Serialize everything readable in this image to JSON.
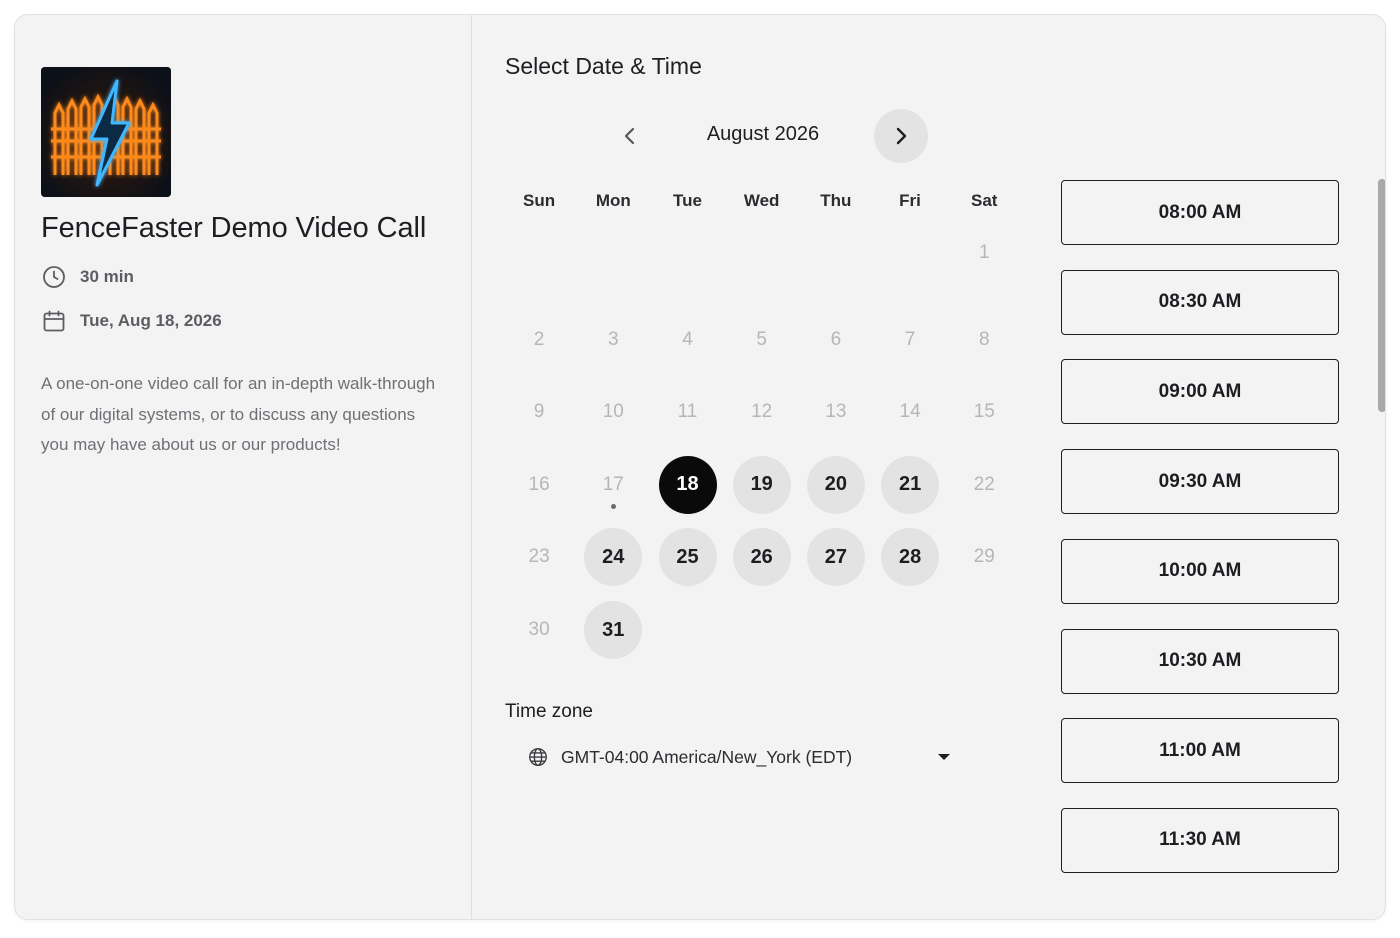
{
  "event": {
    "logo_icon": "neon-fence-lightning-logo",
    "title": "FenceFaster Demo Video Call",
    "duration": "30 min",
    "date": "Tue, Aug 18, 2026",
    "description": "A one-on-one video call for an in-depth walk-through of our digital systems, or to discuss any questions you may have about us or our products!"
  },
  "scheduler": {
    "title": "Select Date & Time",
    "month_label": "August 2026",
    "prev_icon": "chevron-left-icon",
    "next_icon": "chevron-right-icon",
    "weekdays": [
      "Sun",
      "Mon",
      "Tue",
      "Wed",
      "Thu",
      "Fri",
      "Sat"
    ],
    "days": [
      {
        "label": "1",
        "state": "disabled"
      },
      {
        "label": "2",
        "state": "disabled"
      },
      {
        "label": "3",
        "state": "disabled"
      },
      {
        "label": "4",
        "state": "disabled"
      },
      {
        "label": "5",
        "state": "disabled"
      },
      {
        "label": "6",
        "state": "disabled"
      },
      {
        "label": "7",
        "state": "disabled"
      },
      {
        "label": "8",
        "state": "disabled"
      },
      {
        "label": "9",
        "state": "disabled"
      },
      {
        "label": "10",
        "state": "disabled"
      },
      {
        "label": "11",
        "state": "disabled"
      },
      {
        "label": "12",
        "state": "disabled"
      },
      {
        "label": "13",
        "state": "disabled"
      },
      {
        "label": "14",
        "state": "disabled"
      },
      {
        "label": "15",
        "state": "disabled"
      },
      {
        "label": "16",
        "state": "disabled"
      },
      {
        "label": "17",
        "state": "disabled",
        "today": true
      },
      {
        "label": "18",
        "state": "selected"
      },
      {
        "label": "19",
        "state": "available"
      },
      {
        "label": "20",
        "state": "available"
      },
      {
        "label": "21",
        "state": "available"
      },
      {
        "label": "22",
        "state": "disabled"
      },
      {
        "label": "23",
        "state": "disabled"
      },
      {
        "label": "24",
        "state": "available"
      },
      {
        "label": "25",
        "state": "available"
      },
      {
        "label": "26",
        "state": "available"
      },
      {
        "label": "27",
        "state": "available"
      },
      {
        "label": "28",
        "state": "available"
      },
      {
        "label": "29",
        "state": "disabled"
      },
      {
        "label": "30",
        "state": "disabled"
      },
      {
        "label": "31",
        "state": "available"
      }
    ],
    "timezone_label": "Time zone",
    "timezone_value": "GMT-04:00 America/New_York (EDT)"
  },
  "slots": [
    "08:00 AM",
    "08:30 AM",
    "09:00 AM",
    "09:30 AM",
    "10:00 AM",
    "10:30 AM",
    "11:00 AM",
    "11:30 AM"
  ],
  "colors": {
    "selected_day": "#0a0a0a",
    "available_day": "#e3e3e3",
    "disabled_day_text": "#b5b6b9",
    "card_background": "#f3f3f3"
  }
}
